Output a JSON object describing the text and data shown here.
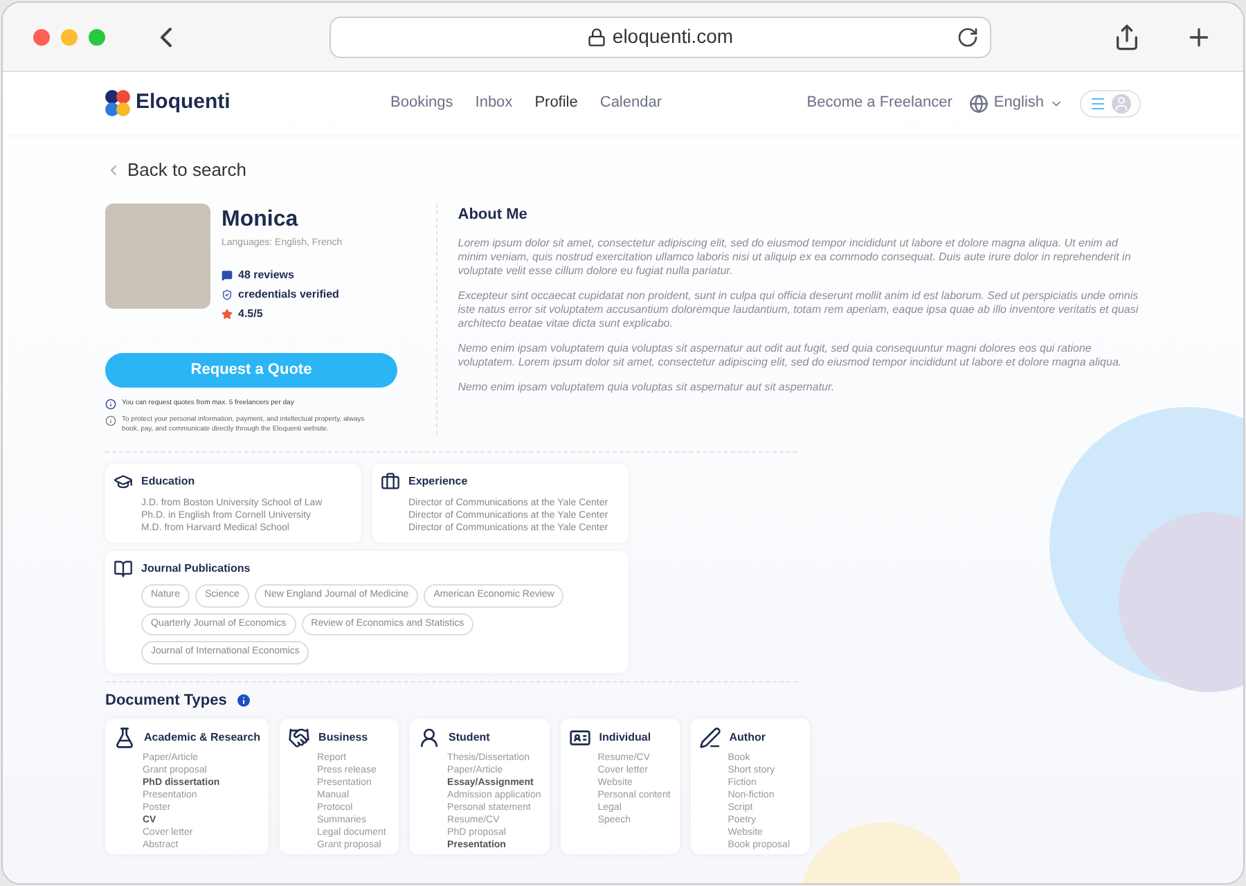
{
  "browser": {
    "url": "eloquenti.com"
  },
  "nav": {
    "logo": "Eloquenti",
    "links": [
      {
        "label": "Bookings",
        "selected": false
      },
      {
        "label": "Inbox",
        "selected": false
      },
      {
        "label": "Profile",
        "selected": true
      },
      {
        "label": "Calendar",
        "selected": false
      }
    ],
    "become": "Become a Freelancer",
    "language": "English"
  },
  "back": "Back to search",
  "profile": {
    "name": "Monica",
    "languages": "Languages: English, French",
    "reviews": "48 reviews",
    "verified": "credentials verified",
    "rating": "4.5/5",
    "button": "Request a Quote",
    "note": "You can request quotes from max. 5 freelancers per day",
    "notice": "To protect your personal information, payment, and intellectual property, always book, pay, and communicate directly through the Eloquenti website."
  },
  "about": {
    "title": "About Me",
    "paragraphs": [
      "Lorem ipsum dolor sit amet, consectetur adipiscing elit, sed do eiusmod tempor incididunt ut labore et dolore magna aliqua. Ut enim ad minim veniam, quis nostrud exercitation ullamco laboris nisi ut aliquip ex ea commodo consequat. Duis aute irure dolor in reprehenderit in voluptate velit esse cillum dolore eu fugiat nulla pariatur.",
      "Excepteur sint occaecat cupidatat non proident, sunt in culpa qui officia deserunt mollit anim id est laborum. Sed ut perspiciatis unde omnis iste natus error sit voluptatem accusantium doloremque laudantium, totam rem aperiam, eaque ipsa quae ab illo inventore veritatis et quasi architecto beatae vitae dicta sunt explicabo.",
      "Nemo enim ipsam voluptatem quia voluptas sit aspernatur aut odit aut fugit, sed quia consequuntur magni dolores eos qui ratione voluptatem. Lorem ipsum dolor sit amet, consectetur adipiscing elit, sed do eiusmod tempor incididunt ut labore et dolore magna aliqua.",
      "Nemo enim ipsam voluptatem quia voluptas sit aspernatur aut sit aspernatur."
    ]
  },
  "education": {
    "title": "Education",
    "lines": [
      "J.D. from Boston University School of Law",
      "Ph.D. in English from Cornell University",
      "M.D. from Harvard Medical School"
    ]
  },
  "experience": {
    "title": "Experience",
    "lines": [
      "Director of Communications at the Yale Center",
      "Director of Communications at the Yale Center",
      "Director of Communications at the Yale Center"
    ]
  },
  "journals": {
    "title": "Journal Publications",
    "tags": [
      "Nature",
      "Science",
      "New England Journal of Medicine",
      "American Economic Review",
      "Quarterly Journal of Economics",
      "Review of Economics and Statistics",
      "Journal of International Economics"
    ]
  },
  "document_types": {
    "title": "Document Types",
    "categories": [
      {
        "kind": "academic",
        "title": "Academic & Research",
        "items": [
          {
            "label": "Paper/Article",
            "bold": false
          },
          {
            "label": "Grant proposal",
            "bold": false
          },
          {
            "label": "PhD dissertation",
            "bold": true
          },
          {
            "label": "Presentation",
            "bold": false
          },
          {
            "label": "Poster",
            "bold": false
          },
          {
            "label": "CV",
            "bold": true
          },
          {
            "label": "Cover letter",
            "bold": false
          },
          {
            "label": "Abstract",
            "bold": false
          }
        ]
      },
      {
        "kind": "business",
        "title": "Business",
        "items": [
          {
            "label": "Report",
            "bold": false
          },
          {
            "label": "Press release",
            "bold": false
          },
          {
            "label": "Presentation",
            "bold": false
          },
          {
            "label": "Manual",
            "bold": false
          },
          {
            "label": "Protocol",
            "bold": false
          },
          {
            "label": "Summaries",
            "bold": false
          },
          {
            "label": "Legal document",
            "bold": false
          },
          {
            "label": "Grant proposal",
            "bold": false
          }
        ]
      },
      {
        "kind": "student",
        "title": "Student",
        "items": [
          {
            "label": "Thesis/Dissertation",
            "bold": false
          },
          {
            "label": "Paper/Article",
            "bold": false
          },
          {
            "label": "Essay/Assignment",
            "bold": true
          },
          {
            "label": "Admission application",
            "bold": false
          },
          {
            "label": "Personal statement",
            "bold": false
          },
          {
            "label": "Resume/CV",
            "bold": false
          },
          {
            "label": "PhD proposal",
            "bold": false
          },
          {
            "label": "Presentation",
            "bold": true
          }
        ]
      },
      {
        "kind": "individual",
        "title": "Individual",
        "items": [
          {
            "label": "Resume/CV",
            "bold": false
          },
          {
            "label": "Cover letter",
            "bold": false
          },
          {
            "label": "Website",
            "bold": false
          },
          {
            "label": "Personal content",
            "bold": false
          },
          {
            "label": "Legal",
            "bold": false
          },
          {
            "label": "Speech",
            "bold": false
          }
        ]
      },
      {
        "kind": "author",
        "title": "Author",
        "items": [
          {
            "label": "Book",
            "bold": false
          },
          {
            "label": "Short story",
            "bold": false
          },
          {
            "label": "Fiction",
            "bold": false
          },
          {
            "label": "Non-fiction",
            "bold": false
          },
          {
            "label": "Script",
            "bold": false
          },
          {
            "label": "Poetry",
            "bold": false
          },
          {
            "label": "Website",
            "bold": false
          },
          {
            "label": "Book proposal",
            "bold": false
          }
        ]
      }
    ]
  }
}
